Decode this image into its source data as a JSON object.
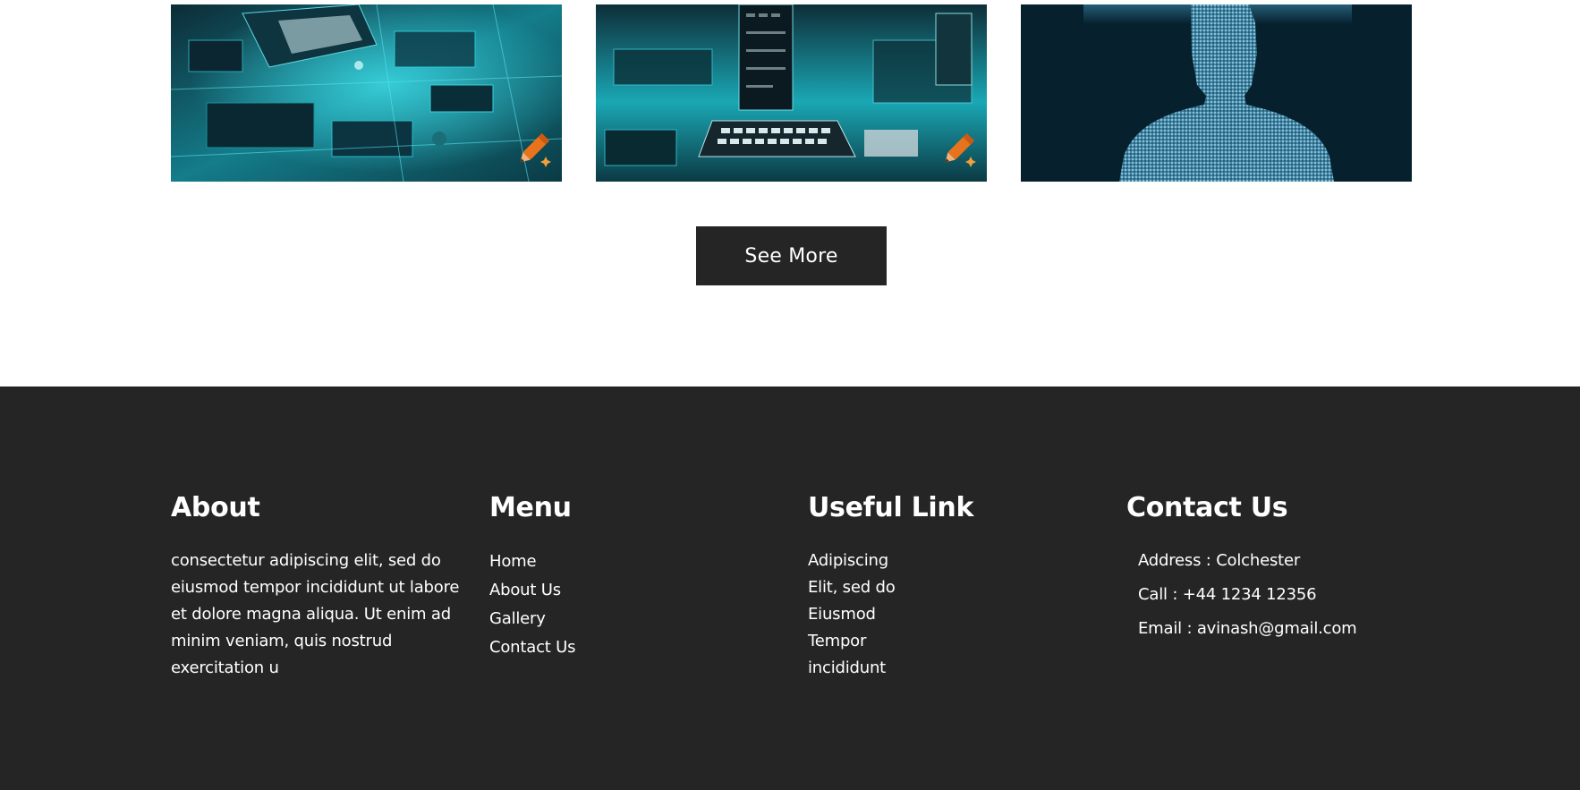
{
  "gallery": {
    "cards": [
      {
        "name": "circuit-board-image",
        "edit_icon": "pencil-icon"
      },
      {
        "name": "workstation-image",
        "edit_icon": "pencil-icon"
      },
      {
        "name": "digital-human-image"
      }
    ],
    "see_more_label": "See More"
  },
  "footer": {
    "about": {
      "title": "About",
      "text": "consectetur adipiscing elit, sed do eiusmod tempor incididunt ut labore et dolore magna aliqua. Ut enim ad minim veniam, quis nostrud exercitation u"
    },
    "menu": {
      "title": "Menu",
      "items": [
        "Home",
        "About Us",
        "Gallery",
        "Contact Us"
      ]
    },
    "useful": {
      "title": "Useful Link",
      "items": [
        "Adipiscing",
        "Elit, sed do",
        "Eiusmod",
        "Tempor",
        "incididunt"
      ]
    },
    "contact": {
      "title": "Contact Us",
      "address": "Address : Colchester",
      "call": "Call : +44 1234 12356",
      "email": "Email : avinash@gmail.com"
    }
  },
  "colors": {
    "footer_bg": "#252525",
    "button_bg": "#252525",
    "accent_teal": "#2fc9d6",
    "pencil_orange": "#e8731c"
  }
}
